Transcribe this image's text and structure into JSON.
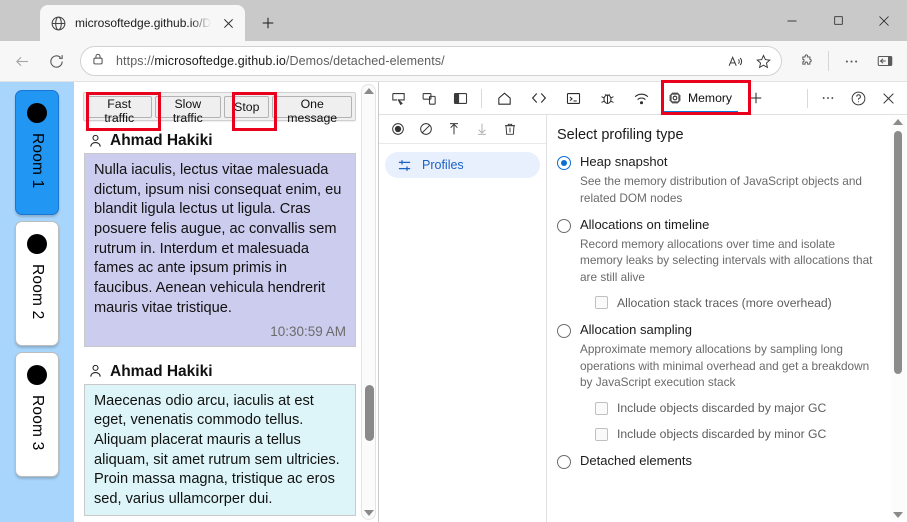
{
  "browser": {
    "tab": {
      "title": "microsoftedge.github.io/Demos/d",
      "favicon_icon": "globe-icon",
      "close_icon": "close-icon"
    },
    "new_tab_icon": "plus-icon",
    "window_controls": {
      "minimize_icon": "minimize-icon",
      "maximize_icon": "maximize-icon",
      "close_icon": "close-icon"
    },
    "nav": {
      "back_icon": "back-arrow-icon",
      "reload_icon": "reload-icon",
      "lock_icon": "lock-icon",
      "url_scheme": "https://",
      "url_host": "microsoftedge.github.io",
      "url_path": "/Demos/detached-elements/",
      "read_aloud_icon": "read-aloud-icon",
      "favorite_icon": "star-icon",
      "extensions_icon": "puzzle-piece-icon",
      "settings_icon": "ellipsis-icon",
      "sidebar_icon": "split-screen-icon"
    }
  },
  "page": {
    "rooms": [
      {
        "label": "Room 1",
        "active": true
      },
      {
        "label": "Room 2",
        "active": false
      },
      {
        "label": "Room 3",
        "active": false
      }
    ],
    "toolbar_buttons": [
      {
        "label": "Fast traffic",
        "highlighted": true
      },
      {
        "label": "Slow traffic",
        "highlighted": false
      },
      {
        "label": "Stop",
        "highlighted": true
      },
      {
        "label": "One message",
        "highlighted": false
      }
    ],
    "messages": [
      {
        "author": "Ahmad Hakiki",
        "text": "Nulla iaculis, lectus vitae malesuada dictum, ipsum nisi consequat enim, eu blandit ligula lectus ut ligula. Cras posuere felis augue, ac convallis sem rutrum in. Interdum et malesuada fames ac ante ipsum primis in faucibus. Aenean vehicula hendrerit mauris vitae tristique.",
        "time": "10:30:59 AM",
        "bubble_color": "#ccccee"
      },
      {
        "author": "Ahmad Hakiki",
        "text": "Maecenas odio arcu, iaculis at est eget, venenatis commodo tellus. Aliquam placerat mauris a tellus aliquam, sit amet rutrum sem ultricies. Proin massa magna, tristique ac eros sed, varius ullamcorper dui.",
        "time": "",
        "bubble_color": "#ddf5f8"
      }
    ],
    "person_icon": "person-icon"
  },
  "devtools": {
    "left_icons": [
      {
        "name": "inspect-element-icon"
      },
      {
        "name": "device-emulation-icon"
      },
      {
        "name": "dock-side-icon"
      }
    ],
    "tabs": [
      {
        "label": "",
        "icon": "home-icon",
        "selected": false
      },
      {
        "label": "",
        "icon": "elements-icon",
        "selected": false
      },
      {
        "label": "",
        "icon": "console-icon",
        "selected": false
      },
      {
        "label": "",
        "icon": "sources-debugger-icon",
        "selected": false
      },
      {
        "label": "",
        "icon": "network-icon",
        "selected": false
      },
      {
        "label": "Memory",
        "icon": "memory-chip-icon",
        "selected": true
      }
    ],
    "add_tab_icon": "plus-icon",
    "more_tools_icon": "ellipsis-icon",
    "help_icon": "help-circle-icon",
    "close_icon": "close-icon",
    "memory_toolbar": [
      {
        "name": "record-icon",
        "enabled": true
      },
      {
        "name": "clear-icon",
        "enabled": true
      },
      {
        "name": "load-profile-icon",
        "enabled": true
      },
      {
        "name": "save-profile-icon",
        "enabled": false
      },
      {
        "name": "delete-icon",
        "enabled": true
      }
    ],
    "sidebar": {
      "profiles_label": "Profiles",
      "profiles_icon": "sliders-icon"
    },
    "memory_panel": {
      "title": "Select profiling type",
      "options": [
        {
          "label": "Heap snapshot",
          "checked": true,
          "description": "See the memory distribution of JavaScript objects and related DOM nodes",
          "checkboxes": []
        },
        {
          "label": "Allocations on timeline",
          "checked": false,
          "description": "Record memory allocations over time and isolate memory leaks by selecting intervals with allocations that are still alive",
          "checkboxes": [
            {
              "label": "Allocation stack traces (more overhead)",
              "checked": false
            }
          ]
        },
        {
          "label": "Allocation sampling",
          "checked": false,
          "description": "Approximate memory allocations by sampling long operations with minimal overhead and get a breakdown by JavaScript execution stack",
          "checkboxes": [
            {
              "label": "Include objects discarded by major GC",
              "checked": false
            },
            {
              "label": "Include objects discarded by minor GC",
              "checked": false
            }
          ]
        },
        {
          "label": "Detached elements",
          "checked": false,
          "description": "",
          "checkboxes": []
        }
      ]
    }
  },
  "annotations": {
    "highlight_color": "#e8001c",
    "boxes": [
      "fast-traffic-button",
      "stop-button",
      "memory-tab"
    ]
  }
}
